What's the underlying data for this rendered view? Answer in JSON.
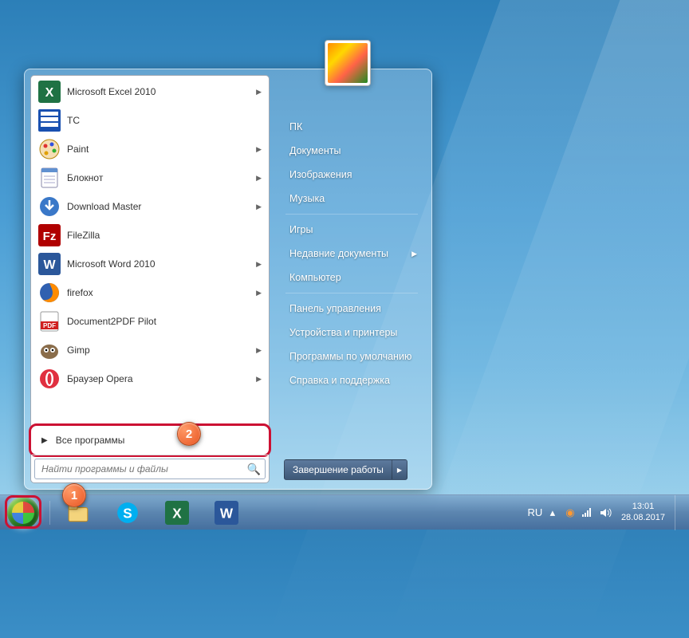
{
  "programs": [
    {
      "label": "Microsoft Excel 2010",
      "icon": "excel",
      "arrow": true
    },
    {
      "label": "TC",
      "icon": "tc",
      "arrow": false
    },
    {
      "label": "Paint",
      "icon": "paint",
      "arrow": true
    },
    {
      "label": "Блокнот",
      "icon": "notepad",
      "arrow": true
    },
    {
      "label": "Download Master",
      "icon": "dm",
      "arrow": true
    },
    {
      "label": "FileZilla",
      "icon": "filezilla",
      "arrow": false
    },
    {
      "label": "Microsoft Word 2010",
      "icon": "word",
      "arrow": true
    },
    {
      "label": "firefox",
      "icon": "firefox",
      "arrow": true
    },
    {
      "label": "Document2PDF Pilot",
      "icon": "pdf",
      "arrow": false
    },
    {
      "label": "Gimp",
      "icon": "gimp",
      "arrow": true
    },
    {
      "label": "Браузер Opera",
      "icon": "opera",
      "arrow": true
    }
  ],
  "all_programs": "Все программы",
  "search": {
    "placeholder": "Найти программы и файлы"
  },
  "right_items": [
    {
      "label": "ПК",
      "arrow": false,
      "sep_after": false
    },
    {
      "label": "Документы",
      "arrow": false,
      "sep_after": false
    },
    {
      "label": "Изображения",
      "arrow": false,
      "sep_after": false
    },
    {
      "label": "Музыка",
      "arrow": false,
      "sep_after": true
    },
    {
      "label": "Игры",
      "arrow": false,
      "sep_after": false
    },
    {
      "label": "Недавние документы",
      "arrow": true,
      "sep_after": false
    },
    {
      "label": "Компьютер",
      "arrow": false,
      "sep_after": true
    },
    {
      "label": "Панель управления",
      "arrow": false,
      "sep_after": false
    },
    {
      "label": "Устройства и принтеры",
      "arrow": false,
      "sep_after": false
    },
    {
      "label": "Программы по умолчанию",
      "arrow": false,
      "sep_after": false
    },
    {
      "label": "Справка и поддержка",
      "arrow": false,
      "sep_after": false
    }
  ],
  "shutdown": {
    "label": "Завершение работы"
  },
  "taskbar": {
    "items": [
      "explorer",
      "skype",
      "excel",
      "word"
    ]
  },
  "tray": {
    "lang": "RU",
    "time": "13:01",
    "date": "28.08.2017"
  },
  "badges": {
    "one": "1",
    "two": "2"
  }
}
